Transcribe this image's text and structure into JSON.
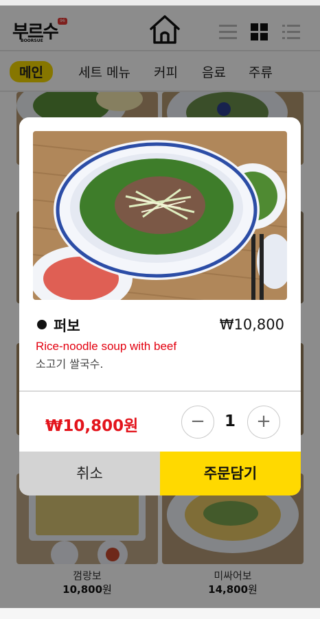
{
  "header": {
    "logo_text": "부르수",
    "logo_sub": "BOORSUE",
    "logo_badge": "96",
    "home_icon": "home-icon",
    "view_icons": [
      "list-lines-icon",
      "grid-icon",
      "bullet-list-icon"
    ]
  },
  "categories": {
    "items": [
      "메인",
      "세트 메뉴",
      "커피",
      "음료",
      "주류"
    ],
    "active": "메인"
  },
  "grid": {
    "tiles": [
      {
        "name": "껌랑보",
        "price_num": "10,800",
        "price_unit": "원"
      },
      {
        "name": "미싸어보",
        "price_num": "14,800",
        "price_unit": "원"
      }
    ]
  },
  "modal": {
    "title": "퍼보",
    "price": "₩10,800",
    "name_en": "Rice-noodle soup with beef",
    "name_ko": "소고기 쌀국수.",
    "total": "₩10,800원",
    "quantity": "1",
    "minus_label": "−",
    "plus_label": "+",
    "cancel_label": "취소",
    "order_label": "주문담기"
  },
  "colors": {
    "accent_yellow": "#ffd900",
    "price_red": "#e3131b",
    "en_red": "#e3000f",
    "cancel_gray": "#d3d3d3"
  }
}
